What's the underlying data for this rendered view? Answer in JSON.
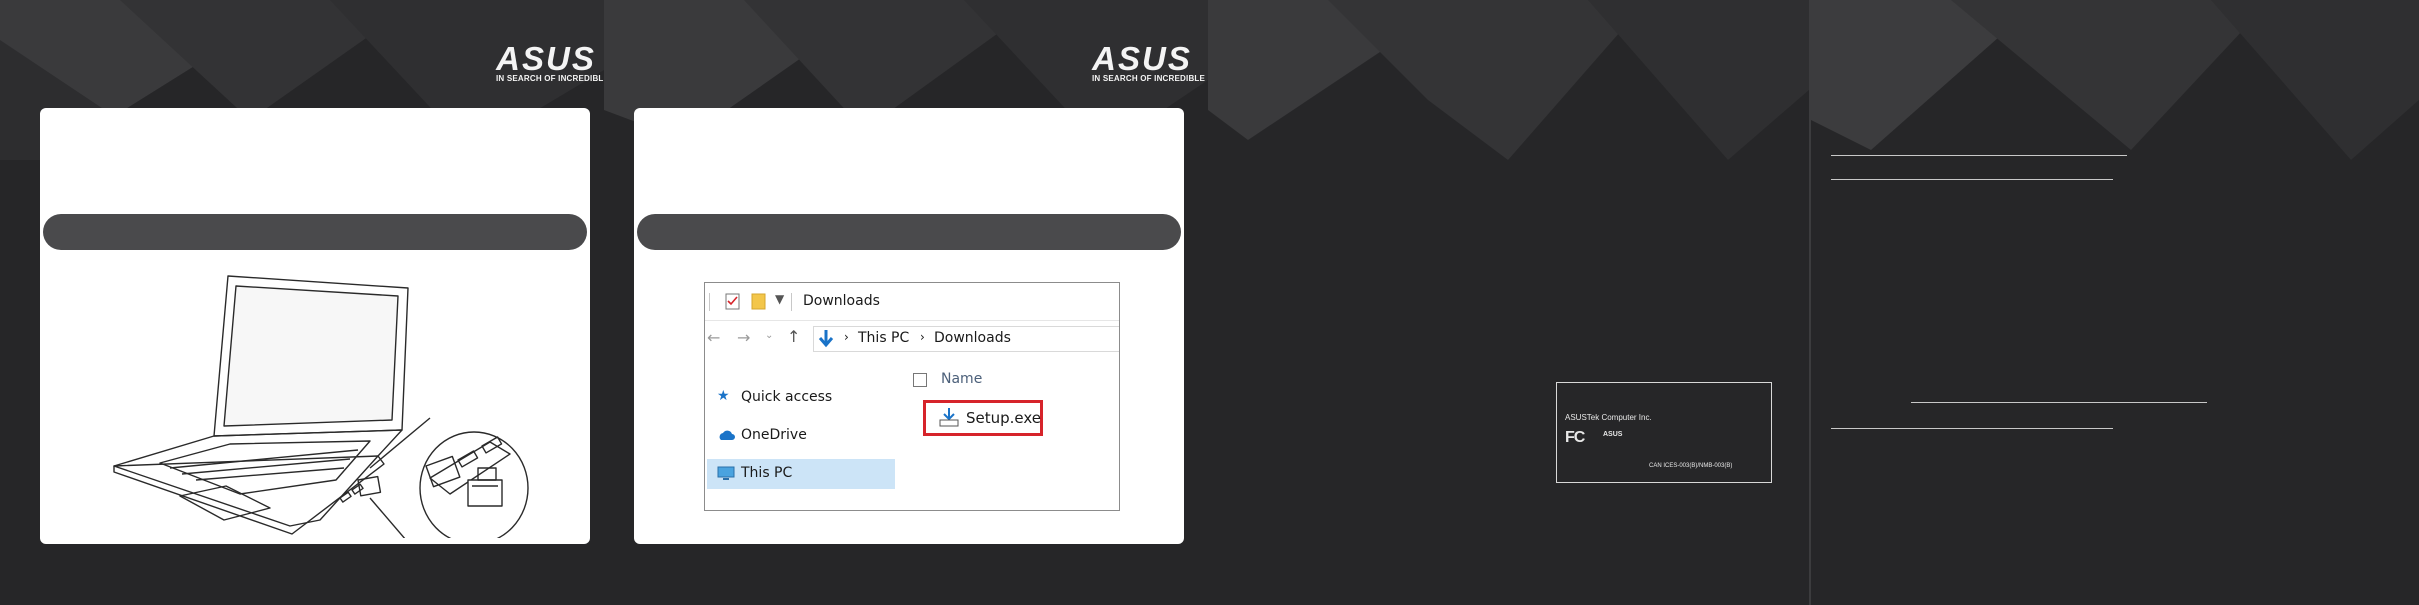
{
  "panels": {
    "panel1": {
      "logo": {
        "wordmark": "ASUS",
        "tagline": "IN SEARCH OF INCREDIBLE"
      }
    },
    "panel2": {
      "logo": {
        "wordmark": "ASUS",
        "tagline": "IN SEARCH OF INCREDIBLE"
      },
      "explorer": {
        "title": "Downloads",
        "breadcrumb": [
          "This PC",
          "Downloads"
        ],
        "sidebar": [
          {
            "label": "Quick access",
            "icon": "star-icon"
          },
          {
            "label": "OneDrive",
            "icon": "cloud-icon"
          },
          {
            "label": "This PC",
            "icon": "monitor-icon",
            "selected": true
          }
        ],
        "column_header": "Name",
        "file": {
          "name": "Setup.exe",
          "icon": "installer-icon",
          "highlight_color": "#d6232a"
        }
      }
    },
    "panel3": {
      "fcc_label": {
        "company": "ASUSTek Computer Inc.",
        "brand": "ASUS",
        "code": "CAN ICES-003(B)/NMB-003(B)"
      }
    }
  },
  "colors": {
    "background": "#252527",
    "card": "#ffffff",
    "pill": "#4a4a4c",
    "selection": "#cce4f7",
    "accent_blue": "#1a73c8"
  }
}
